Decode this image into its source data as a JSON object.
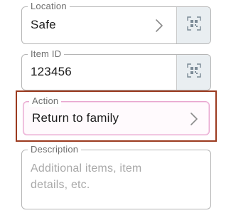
{
  "location": {
    "label": "Location",
    "value": "Safe",
    "chevron_icon": "chevron-right-icon",
    "scan_icon": "qr-scan-icon"
  },
  "item_id": {
    "label": "Item ID",
    "value": "123456",
    "scan_icon": "qr-scan-icon"
  },
  "action": {
    "label": "Action",
    "value": "Return to family",
    "chevron_icon": "chevron-right-icon",
    "highlight_color": "#9b3a1f",
    "focus_color": "#e8a6cf"
  },
  "description": {
    "label": "Description",
    "placeholder": "Additional items, item details, etc."
  }
}
